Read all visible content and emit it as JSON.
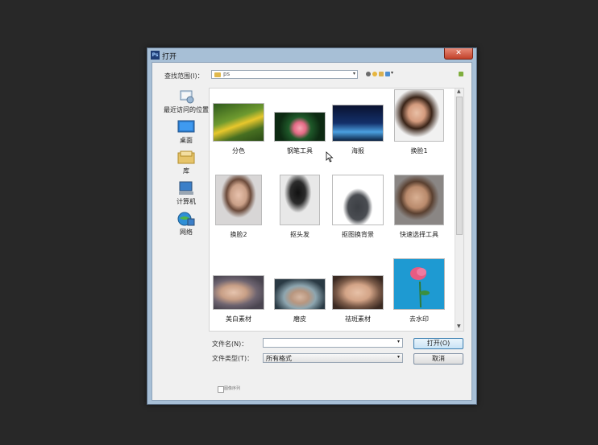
{
  "window": {
    "title": "打开",
    "app_icon": "Ps",
    "close_label": "✕"
  },
  "lookin": {
    "label": "查找范围(I)：",
    "value": "ps"
  },
  "places": [
    {
      "label": "最近访问的位置",
      "icon": "recent-places-icon"
    },
    {
      "label": "桌面",
      "icon": "desktop-icon"
    },
    {
      "label": "库",
      "icon": "libraries-icon"
    },
    {
      "label": "计算机",
      "icon": "computer-icon"
    },
    {
      "label": "网络",
      "icon": "network-icon"
    }
  ],
  "files": [
    {
      "label": "分色"
    },
    {
      "label": "钢笔工具"
    },
    {
      "label": "海报"
    },
    {
      "label": "换脸1"
    },
    {
      "label": "换脸2"
    },
    {
      "label": "抠头发"
    },
    {
      "label": "抠图换背景"
    },
    {
      "label": "快速选择工具"
    },
    {
      "label": "美白素材"
    },
    {
      "label": "磨皮"
    },
    {
      "label": "祛斑素材"
    },
    {
      "label": "去水印"
    }
  ],
  "filename": {
    "label": "文件名(N)：",
    "value": ""
  },
  "filetype": {
    "label": "文件类型(T)：",
    "value": "所有格式"
  },
  "buttons": {
    "open": "打开(O)",
    "cancel": "取消"
  },
  "preview": {
    "label": "图像序列"
  },
  "colors": {
    "backdrop": "#282828",
    "frame": "#a7bfd6",
    "accent": "#3c7fb1"
  }
}
